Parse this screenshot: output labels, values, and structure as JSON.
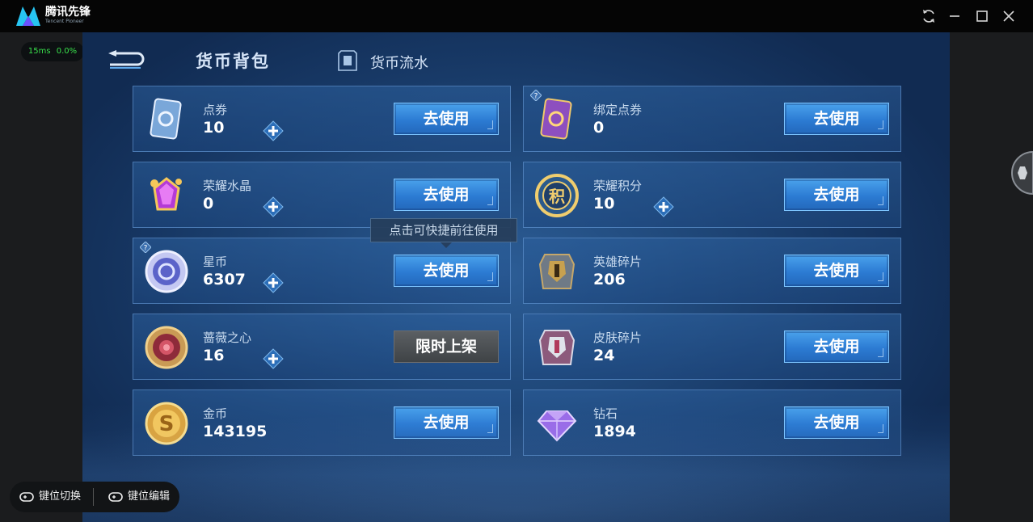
{
  "app": {
    "name": "腾讯先锋",
    "subtitle": "Tencent Pioneer"
  },
  "perf": {
    "latency": "15ms",
    "loss": "0.0%"
  },
  "header": {
    "title": "货币背包",
    "flow_tab": "货币流水"
  },
  "tooltip": "点击可快捷前往使用",
  "currencies_left": [
    {
      "name": "点券",
      "value": "10",
      "button": "去使用",
      "icon": "coupon-icon"
    },
    {
      "name": "荣耀水晶",
      "value": "0",
      "button": "去使用",
      "icon": "crystal-icon"
    },
    {
      "name": "星币",
      "value": "6307",
      "button": "去使用",
      "icon": "star-coin-icon"
    },
    {
      "name": "蔷薇之心",
      "value": "16",
      "button": "限时上架",
      "icon": "rose-heart-icon"
    },
    {
      "name": "金币",
      "value": "143195",
      "button": "去使用",
      "icon": "gold-coin-icon"
    }
  ],
  "currencies_right": [
    {
      "name": "绑定点券",
      "value": "0",
      "button": "去使用",
      "icon": "bound-coupon-icon"
    },
    {
      "name": "荣耀积分",
      "value": "10",
      "button": "去使用",
      "icon": "honor-points-icon"
    },
    {
      "name": "英雄碎片",
      "value": "206",
      "button": "去使用",
      "icon": "hero-fragment-icon"
    },
    {
      "name": "皮肤碎片",
      "value": "24",
      "button": "去使用",
      "icon": "skin-fragment-icon"
    },
    {
      "name": "钻石",
      "value": "1894",
      "button": "去使用",
      "icon": "diamond-icon"
    }
  ],
  "honor_badge": "积",
  "keybar": {
    "switch": "键位切换",
    "edit": "键位编辑"
  },
  "colors": {
    "accent": "#2c7bd3",
    "perf_text": "#39e04b",
    "background": "#173865"
  }
}
